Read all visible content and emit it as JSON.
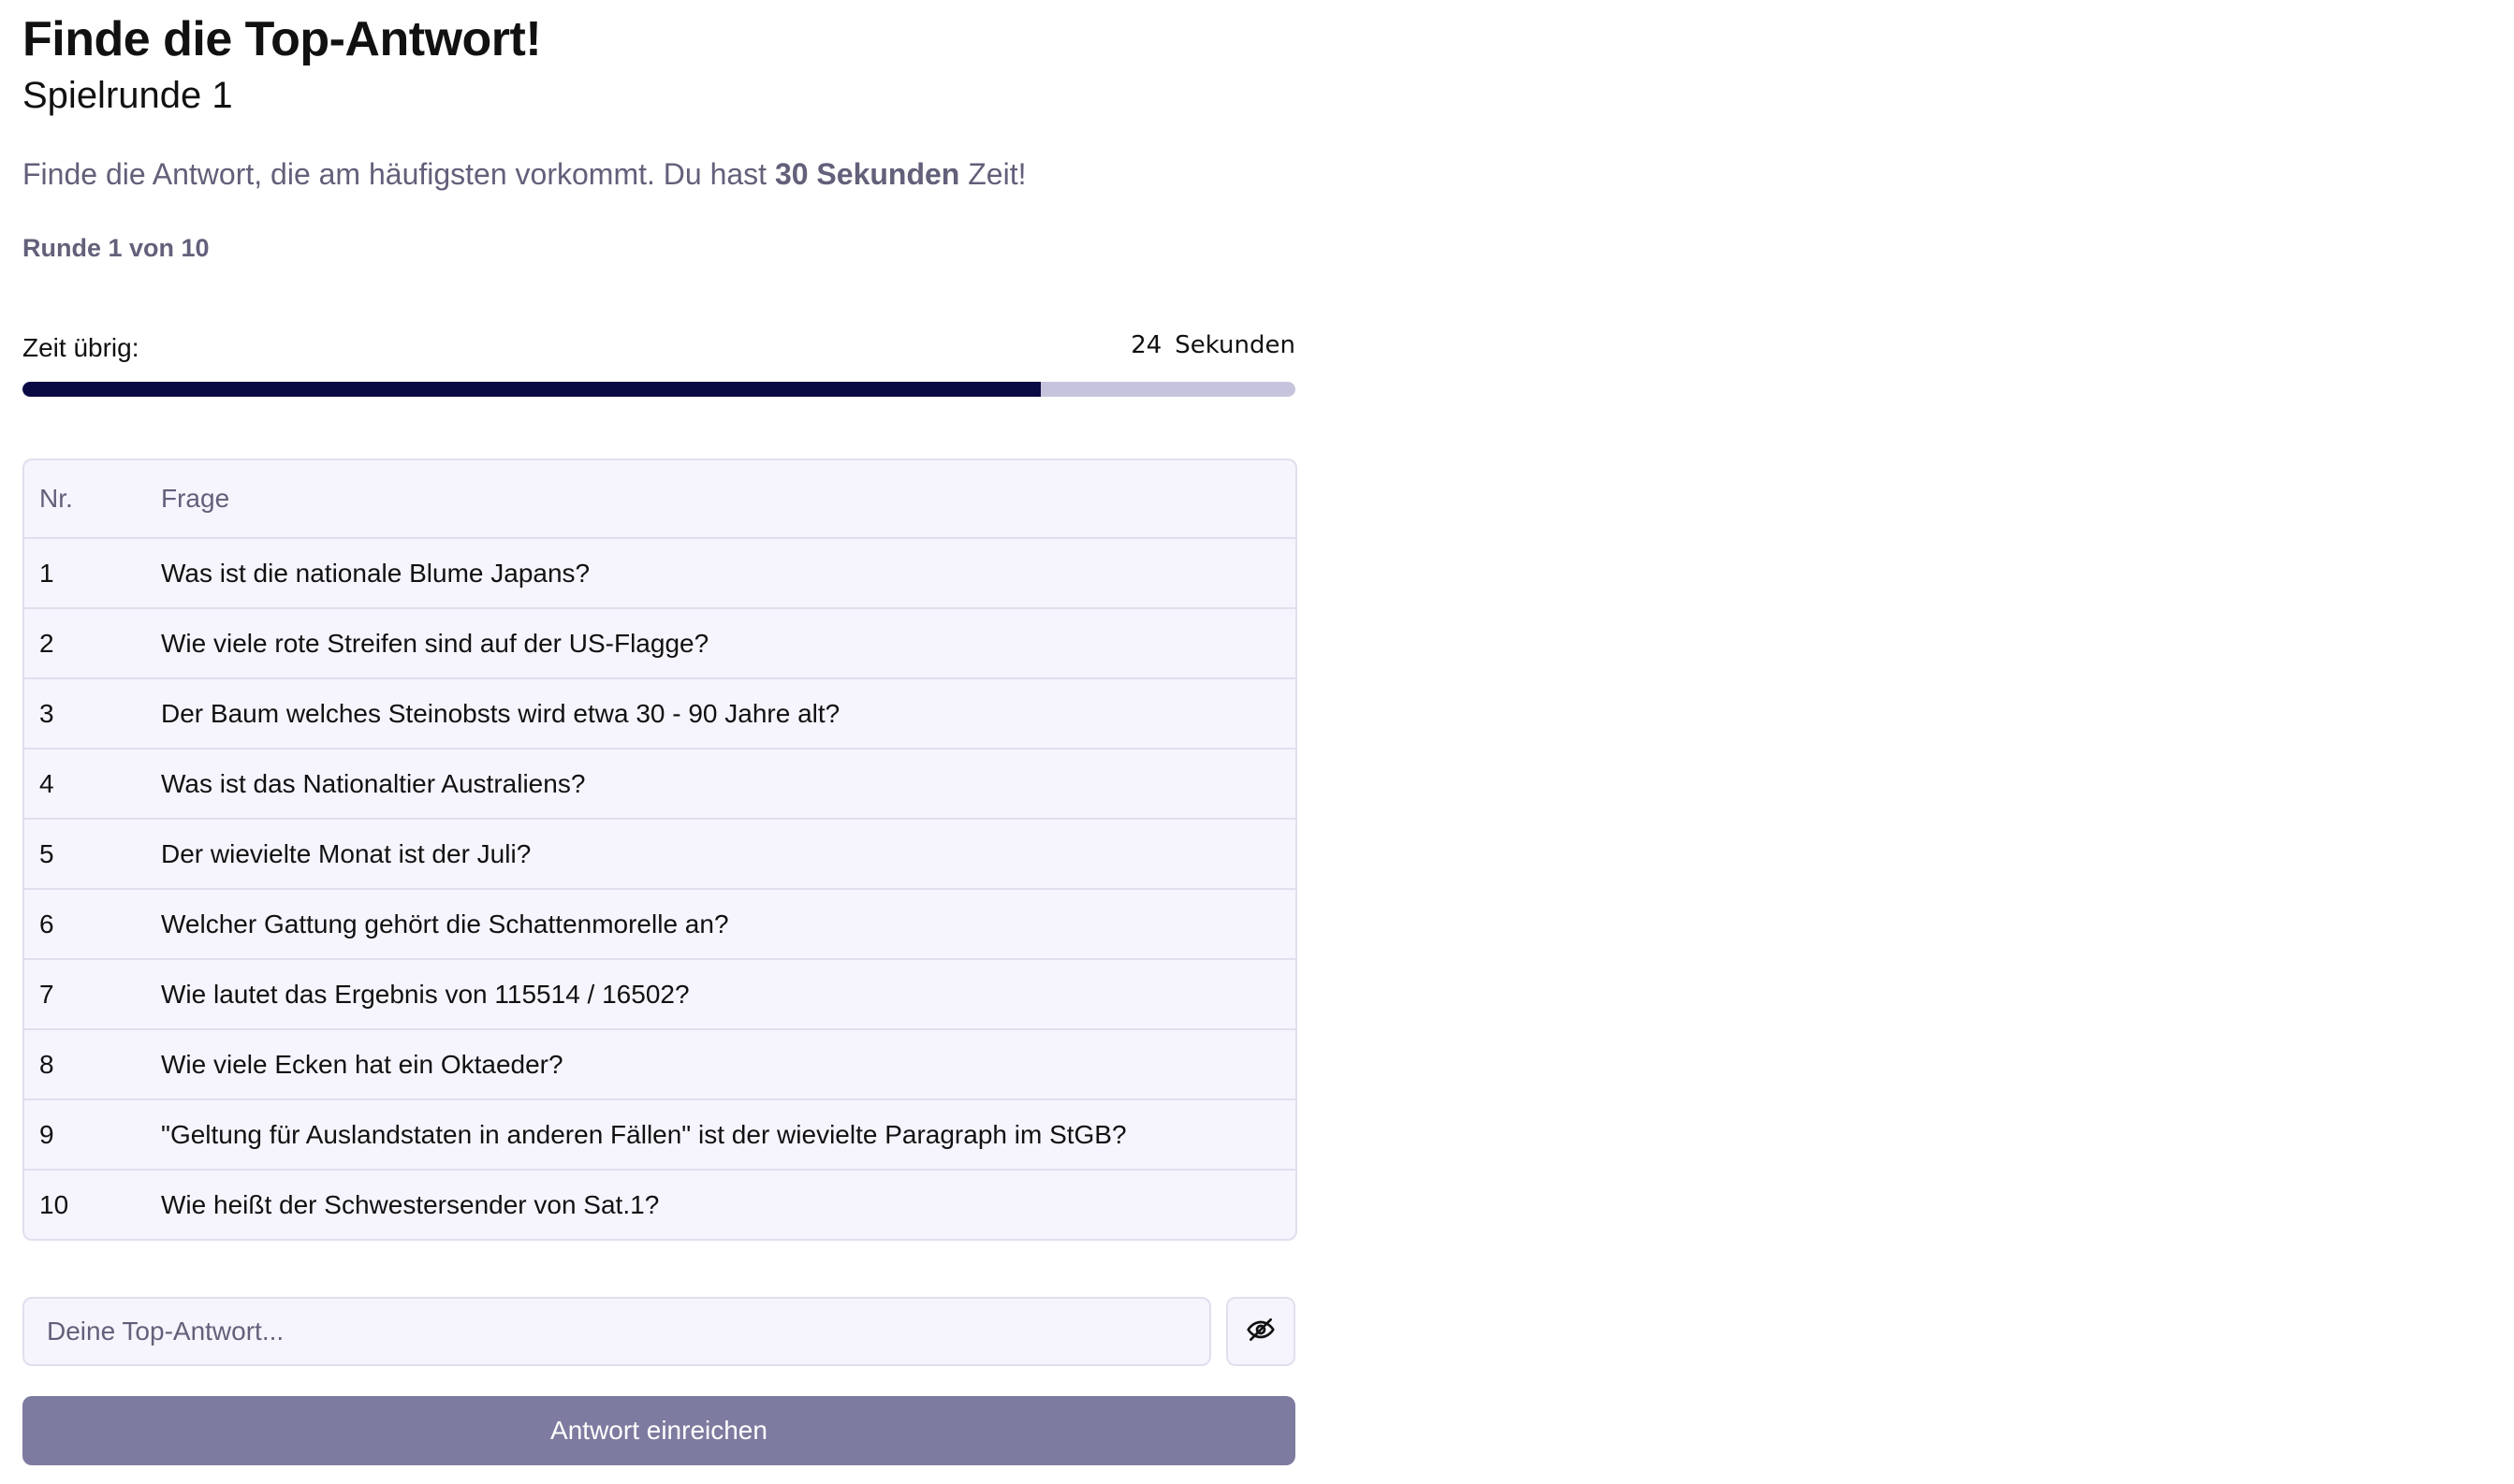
{
  "header": {
    "title": "Finde die Top-Antwort!",
    "subtitle": "Spielrunde 1"
  },
  "instructions": {
    "prefix": "Finde die Antwort, die am häufigsten vorkommt. Du hast ",
    "emphasis": "30 Sekunden",
    "suffix": " Zeit!"
  },
  "round_label": "Runde 1 von 10",
  "timer": {
    "label": "Zeit übrig:",
    "value": "24",
    "unit": "Sekunden",
    "remaining_fraction": 0.8
  },
  "table": {
    "headers": [
      "Nr.",
      "Frage"
    ],
    "rows": [
      {
        "nr": "1",
        "question": "Was ist die nationale Blume Japans?"
      },
      {
        "nr": "2",
        "question": "Wie viele rote Streifen sind auf der US-Flagge?"
      },
      {
        "nr": "3",
        "question": "Der Baum welches Steinobsts wird etwa 30 - 90 Jahre alt?"
      },
      {
        "nr": "4",
        "question": "Was ist das Nationaltier Australiens?"
      },
      {
        "nr": "5",
        "question": "Der wievielte Monat ist der Juli?"
      },
      {
        "nr": "6",
        "question": "Welcher Gattung gehört die Schattenmorelle an?"
      },
      {
        "nr": "7",
        "question": "Wie lautet das Ergebnis von 115514 / 16502?"
      },
      {
        "nr": "8",
        "question": "Wie viele Ecken hat ein Oktaeder?"
      },
      {
        "nr": "9",
        "question": "\"Geltung für Auslandstaten in anderen Fällen\" ist der wievielte Paragraph im StGB?"
      },
      {
        "nr": "10",
        "question": "Wie heißt der Schwestersender von Sat.1?"
      }
    ]
  },
  "answer": {
    "placeholder": "Deine Top-Antwort...",
    "value": "",
    "toggle_icon": "eye-off-icon"
  },
  "submit_label": "Antwort einreichen",
  "colors": {
    "progress_fill": "#090a44",
    "progress_track": "#c6c4dc",
    "submit_bg": "#7e7ba0",
    "table_bg": "#f6f5fd",
    "muted_text": "#62607a"
  }
}
